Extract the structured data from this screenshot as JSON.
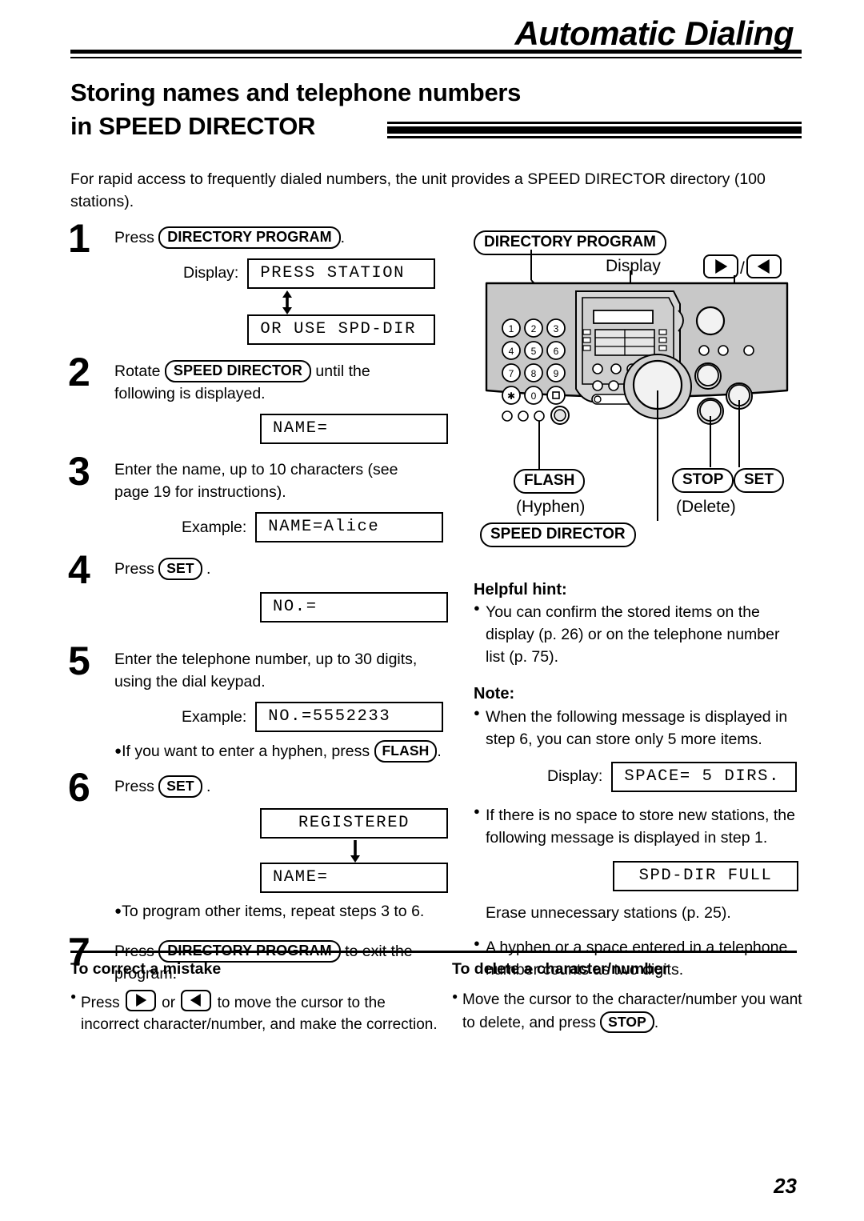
{
  "header": {
    "chapter_title": "Automatic Dialing",
    "section_title_line1": "Storing names and telephone numbers",
    "section_title_line2": "in SPEED DIRECTOR"
  },
  "intro": "For rapid access to frequently dialed numbers, the unit provides a SPEED DIRECTOR directory (100 stations).",
  "steps": [
    {
      "num": "1",
      "text_before": "Press",
      "key": "DIRECTORY PROGRAM",
      "text_after": ".",
      "display_label": "Display:",
      "lcd1": "PRESS STATION",
      "arrow": "double",
      "lcd2": "OR USE SPD-DIR"
    },
    {
      "num": "2",
      "text_before": "Rotate",
      "key": "SPEED DIRECTOR",
      "text_after": "until the",
      "text_line2": "following is displayed.",
      "lcd1": "NAME="
    },
    {
      "num": "3",
      "text_line1": "Enter the name, up to 10 characters (see",
      "text_line2": "page 19 for instructions).",
      "display_label": "Example:",
      "lcd1": "NAME=Alice"
    },
    {
      "num": "4",
      "text_before": "Press",
      "key": "SET",
      "text_after": ".",
      "lcd1": "NO.="
    },
    {
      "num": "5",
      "text_line1": "Enter the telephone number, up to 30 digits,",
      "text_line2": "using the dial keypad.",
      "display_label": "Example:",
      "lcd1": "NO.=5552233",
      "note_before": "If you want to enter a hyphen, press",
      "note_key": "FLASH",
      "note_after": "."
    },
    {
      "num": "6",
      "text_before": "Press",
      "key": "SET",
      "text_after": ".",
      "lcd1": "REGISTERED",
      "arrow": "down",
      "lcd2": "NAME=",
      "note_before": "To program other items, repeat steps 3 to 6."
    },
    {
      "num": "7",
      "text_before": "Press",
      "key": "DIRECTORY PROGRAM",
      "text_after": "to exit the",
      "text_line2": "program."
    }
  ],
  "figure": {
    "callout_directory_program": "DIRECTORY PROGRAM",
    "label_display": "Display",
    "label_cursor_keys": "/",
    "callout_flash": "FLASH",
    "label_hyphen": "(Hyphen)",
    "callout_stop": "STOP",
    "label_delete": "(Delete)",
    "callout_set": "SET",
    "callout_speed_director": "SPEED DIRECTOR",
    "keypad": [
      "1",
      "2",
      "3",
      "4",
      "5",
      "6",
      "7",
      "8",
      "9",
      "∗",
      "0",
      "□"
    ],
    "body_color": "#c8c8c8",
    "outline_color": "#000000"
  },
  "hints": {
    "helpful_hint_title": "Helpful hint:",
    "helpful_hint_items": [
      "You can confirm the stored items on the display (p. 26) or on the telephone number list (p. 75)."
    ],
    "note_title": "Note:",
    "note_item_1": "When the following message is displayed in step 6, you can store only 5 more items.",
    "note_display_label": "Display:",
    "note_lcd_1": "SPACE= 5 DIRS.",
    "note_item_2": "If there is no space to store new stations, the following message is displayed in step 1.",
    "note_lcd_2": "SPD-DIR FULL",
    "note_plain": "Erase unnecessary stations (p. 25).",
    "note_item_3": "A hyphen or a space entered in a telephone number counts as two digits."
  },
  "bottom": {
    "left_title": "To correct a mistake",
    "left_text_1": "Press",
    "left_text_2": "or",
    "left_text_3": "to move the cursor to the incorrect character/number, and make the correction.",
    "right_title": "To delete a character/number",
    "right_text_1": "Move the cursor to the character/number you want to delete, and press",
    "right_key": "STOP",
    "right_text_2": "."
  },
  "page_number": "23"
}
